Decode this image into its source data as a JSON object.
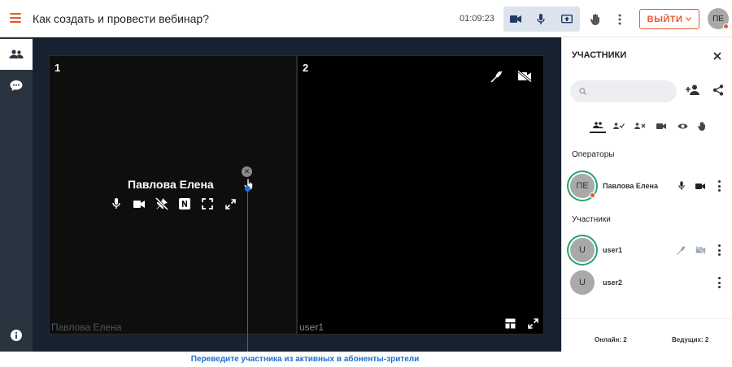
{
  "header": {
    "title": "Как создать и провести вебинар?",
    "timer": "01:09:23",
    "exit_label": "ВЫЙТИ",
    "avatar_initials": "ПЕ",
    "icons": [
      "menu-icon",
      "camera-icon",
      "mic-icon",
      "screen-share-icon",
      "raise-hand-icon",
      "more-icon"
    ]
  },
  "rail": {
    "icons": [
      "participants-icon",
      "chat-icon",
      "info-icon"
    ]
  },
  "stage": {
    "tiles": [
      {
        "number": "1",
        "name": "Павлова Елена",
        "overlay_name": "Павлова Елена"
      },
      {
        "number": "2",
        "name": "user1"
      }
    ]
  },
  "panel": {
    "title": "УЧАСТНИКИ",
    "operators_label": "Операторы",
    "participants_label": "Участники",
    "operators": [
      {
        "initials": "ПЕ",
        "name": "Павлова Елена"
      }
    ],
    "participants": [
      {
        "initials": "U",
        "name": "user1"
      },
      {
        "initials": "U",
        "name": "user2"
      }
    ],
    "online": "Онлайн: 2",
    "hosts": "Ведущих: 2"
  },
  "caption": "Переведите участника из активных в абоненты-зрители",
  "colors": {
    "accent": "#e8572b",
    "online_ring": "#1fa56b",
    "annotation": "#1a6fd1",
    "rail": "#2a3440"
  }
}
